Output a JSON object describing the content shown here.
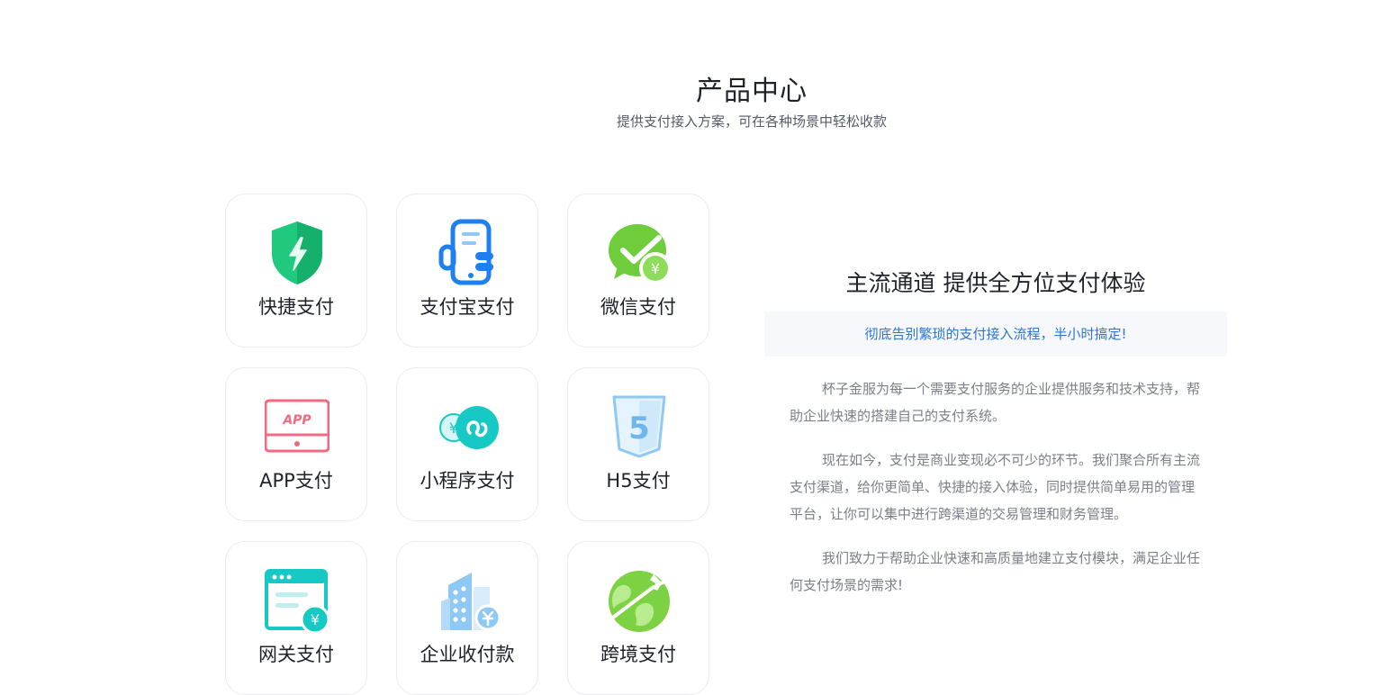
{
  "header": {
    "title": "产品中心",
    "subtitle": "提供支付接入方案，可在各种场景中轻松收款"
  },
  "products": [
    {
      "label": "快捷支付",
      "icon": "shield-lightning-icon"
    },
    {
      "label": "支付宝支付",
      "icon": "phone-hand-icon"
    },
    {
      "label": "微信支付",
      "icon": "wechat-pay-icon"
    },
    {
      "label": "APP支付",
      "icon": "app-screen-icon",
      "icon_text": "APP"
    },
    {
      "label": "小程序支付",
      "icon": "mini-program-icon",
      "icon_text": "¥"
    },
    {
      "label": "H5支付",
      "icon": "html5-icon",
      "icon_text": "5"
    },
    {
      "label": "网关支付",
      "icon": "gateway-window-icon",
      "icon_text": "¥"
    },
    {
      "label": "企业收付款",
      "icon": "building-icon"
    },
    {
      "label": "跨境支付",
      "icon": "globe-plane-icon"
    }
  ],
  "intro": {
    "title": "主流通道 提供全方位支付体验",
    "banner": "彻底告别繁琐的支付接入流程，半小时搞定!",
    "paragraphs": [
      "杯子金服为每一个需要支付服务的企业提供服务和技术支持，帮助企业快速的搭建自己的支付系统。",
      "现在如今，支付是商业变现必不可少的环节。我们聚合所有主流支付渠道，给你更简单、快捷的接入体验，同时提供简单易用的管理平台，让你可以集中进行跨渠道的交易管理和财务管理。",
      "我们致力于帮助企业快速和高质量地建立支付模块，满足企业任何支付场景的需求!"
    ]
  },
  "colors": {
    "green": "#21c97f",
    "blue": "#1e7ff0",
    "wechat_green": "#6fcd3c",
    "pink": "#f06a80",
    "teal": "#17c9c4",
    "light_blue": "#8ec8f4",
    "banner_text": "#2b76d6"
  }
}
